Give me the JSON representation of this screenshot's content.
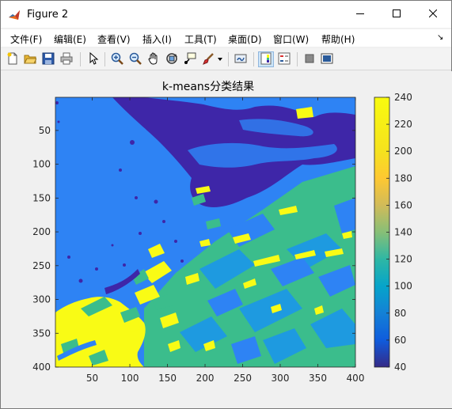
{
  "window": {
    "title": "Figure 2",
    "icon": "matlab-icon",
    "controls": [
      "minimize-icon",
      "maximize-icon",
      "close-icon"
    ]
  },
  "menu": {
    "items": [
      "文件(F)",
      "编辑(E)",
      "查看(V)",
      "插入(I)",
      "工具(T)",
      "桌面(D)",
      "窗口(W)",
      "帮助(H)"
    ],
    "dock_glyph": "↘"
  },
  "toolbar": {
    "buttons": [
      "new-figure-icon",
      "open-file-icon",
      "save-icon",
      "print-icon",
      "edit-plot-icon",
      "zoom-in-icon",
      "zoom-out-icon",
      "pan-icon",
      "rotate-3d-icon",
      "data-cursor-icon",
      "brush-icon",
      "brush-dropdown-icon",
      "link-plot-icon",
      "colorbar-icon",
      "legend-icon",
      "hide-plot-tools-icon",
      "show-plot-tools-icon"
    ]
  },
  "chart_data": {
    "type": "heatmap",
    "title": "k-means分类结果",
    "xlabel": "",
    "ylabel": "",
    "xlim": [
      1,
      400
    ],
    "ylim": [
      1,
      400
    ],
    "y_reversed": true,
    "x_ticks": [
      "50",
      "100",
      "150",
      "200",
      "250",
      "300",
      "350",
      "400"
    ],
    "y_ticks": [
      "50",
      "100",
      "150",
      "200",
      "250",
      "300",
      "350",
      "400"
    ],
    "colormap": "parula",
    "clim": [
      40,
      240
    ],
    "colorbar_ticks": [
      "40",
      "60",
      "80",
      "100",
      "120",
      "140",
      "160",
      "180",
      "200",
      "220",
      "240"
    ],
    "class_levels": [
      {
        "value": 40,
        "color": "#3e26a8"
      },
      {
        "value": 100,
        "color": "#2e83f4"
      },
      {
        "value": 120,
        "color": "#1e9ae0"
      },
      {
        "value": 165,
        "color": "#3bbd8c"
      },
      {
        "value": 240,
        "color": "#f9fb15"
      }
    ]
  }
}
